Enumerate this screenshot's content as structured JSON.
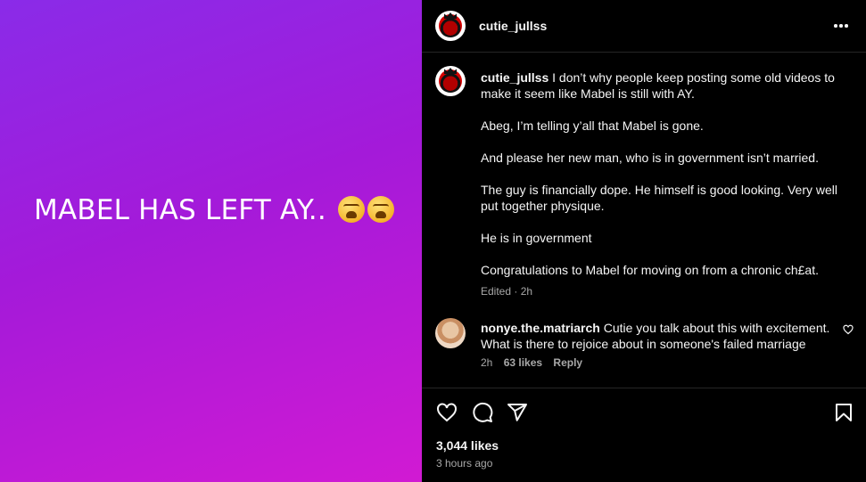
{
  "media": {
    "text": "MABEL HAS LEFT AY.. "
  },
  "header": {
    "username": "cutie_jullss"
  },
  "caption": {
    "username": "cutie_jullss",
    "paragraphs": [
      "I don’t why people keep posting some old videos to make it seem like Mabel is still with AY.",
      "Abeg, I’m telling y’all that Mabel is gone.",
      "And please her new man, who is in government isn’t married.",
      "The guy is financially dope. He himself is good looking. Very well put together physique.",
      "He is in government",
      "Congratulations to Mabel for moving on from a chronic ch£at."
    ],
    "meta": "Edited · 2h"
  },
  "comment": {
    "username": "nonye.the.matriarch",
    "text": "Cutie you talk about this with excitement. What is there to rejoice about in someone's failed marriage",
    "time": "2h",
    "likes": "63 likes",
    "reply": "Reply"
  },
  "footer": {
    "likes": "3,044 likes",
    "time_ago": "3 hours ago"
  },
  "icons": [
    "more-icon",
    "heart-icon",
    "comment-icon",
    "share-icon",
    "bookmark-icon",
    "emoji-weary-icon"
  ],
  "colors": {
    "gradient_start": "#8a2be8",
    "gradient_end": "#d11ad3",
    "panel_bg": "#000000",
    "muted": "#a8a8a8"
  }
}
